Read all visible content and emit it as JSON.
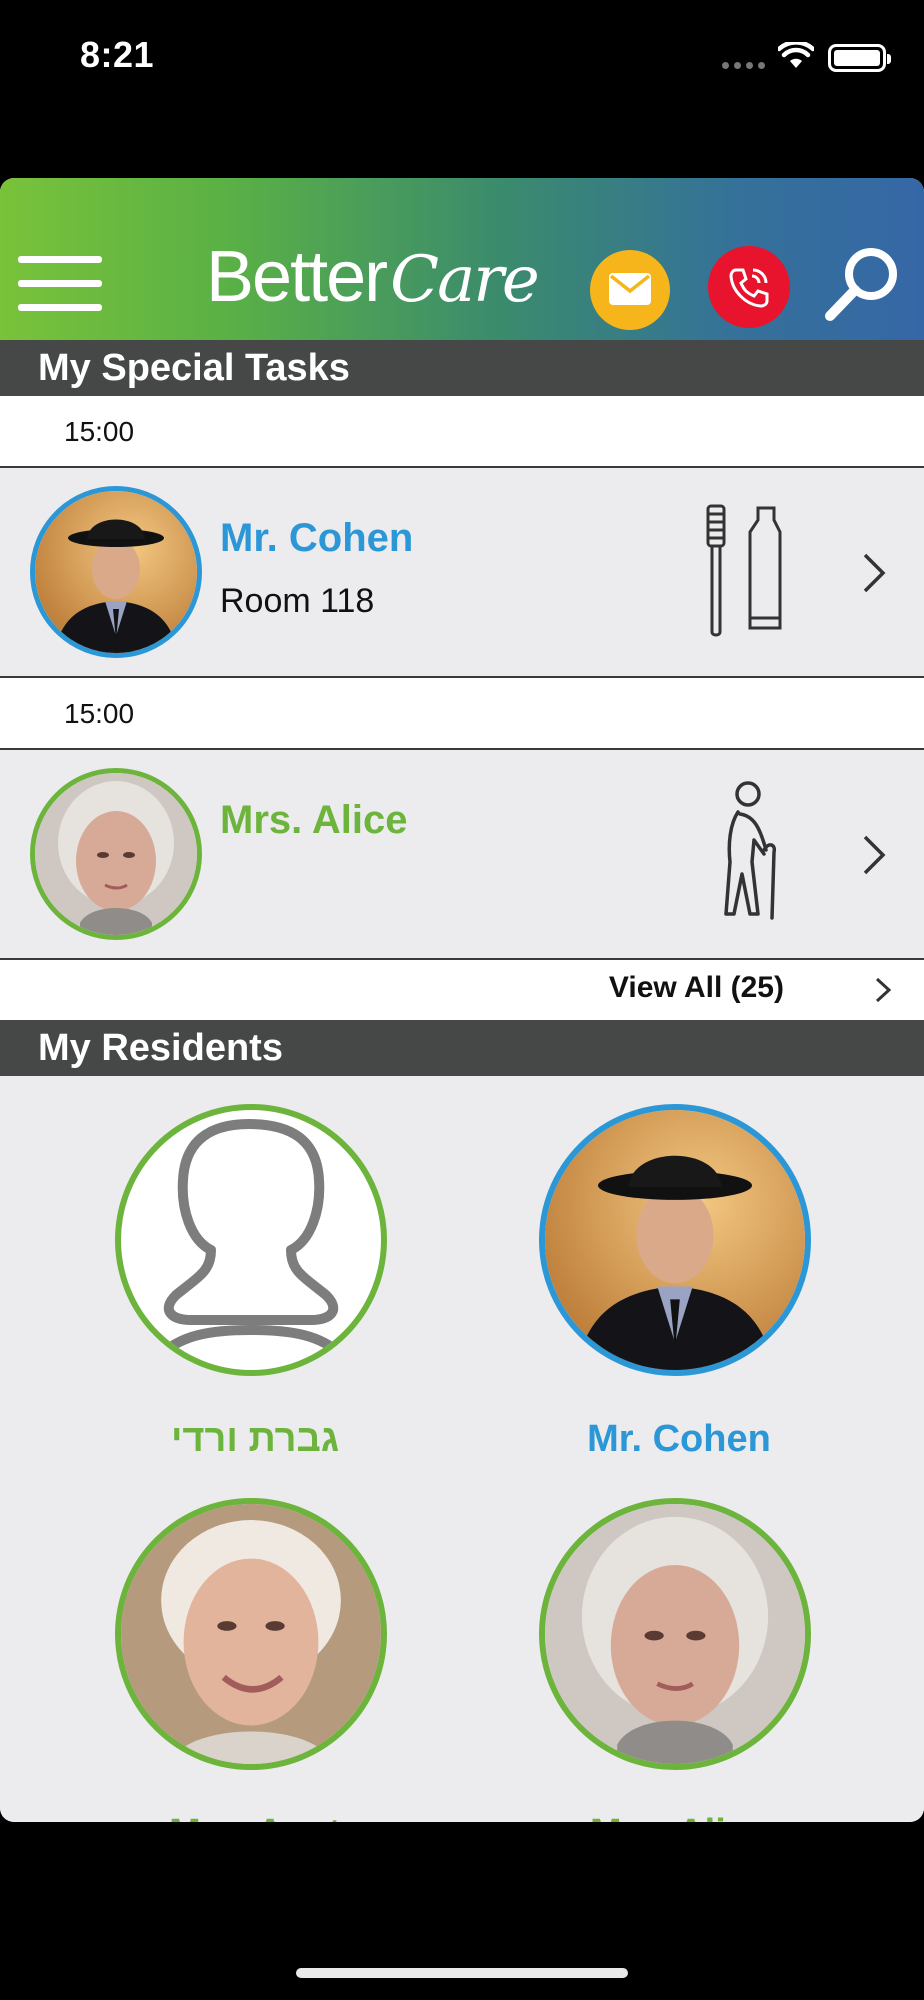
{
  "status_bar": {
    "time": "8:21"
  },
  "header": {
    "logo_better": "Better",
    "logo_care": "Care",
    "colors": {
      "gradient_start": "#79c23a",
      "gradient_end": "#3567a6",
      "mail": "#f5b51b",
      "phone": "#e8132c"
    }
  },
  "special_tasks": {
    "title": "My Special Tasks",
    "tasks": [
      {
        "time": "15:00",
        "name": "Mr.  Cohen",
        "room": "Room 118",
        "task_icon": "toothbrush-toothpaste-icon",
        "color": "#2b97d6"
      },
      {
        "time": "15:00",
        "name": "Mrs. Alice",
        "room": "",
        "task_icon": "walking-cane-icon",
        "color": "#6cb43b"
      }
    ],
    "view_all": "View All (25)"
  },
  "residents": {
    "title": "My Residents",
    "items": [
      {
        "name": "גברת ורדי",
        "color": "#6cb43b"
      },
      {
        "name": "Mr.  Cohen",
        "color": "#2b97d6"
      },
      {
        "name": "Mrs. Anat",
        "color": "#6cb43b"
      },
      {
        "name": "Mrs. Alice",
        "color": "#6cb43b"
      }
    ]
  }
}
